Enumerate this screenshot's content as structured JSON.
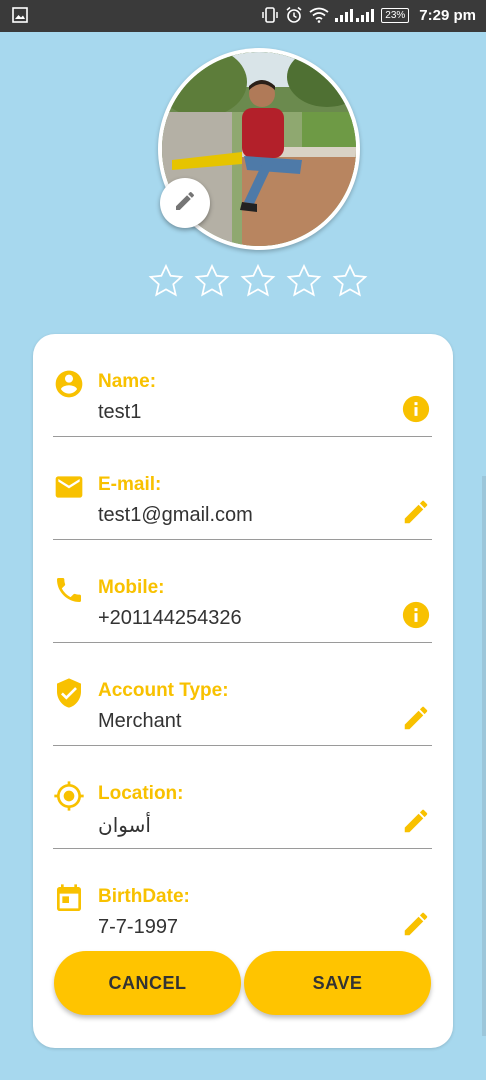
{
  "status_bar": {
    "battery": "23%",
    "time": "7:29 pm"
  },
  "rating": {
    "value": 0,
    "max": 5
  },
  "profile": {
    "fields": [
      {
        "label": "Name:",
        "value": "test1",
        "icon": "person-icon",
        "action": "info-icon"
      },
      {
        "label": "E-mail:",
        "value": "test1@gmail.com",
        "icon": "email-icon",
        "action": "edit-icon"
      },
      {
        "label": "Mobile:",
        "value": "+201144254326",
        "icon": "phone-icon",
        "action": "info-icon"
      },
      {
        "label": "Account Type:",
        "value": "Merchant",
        "icon": "shield-check-icon",
        "action": "edit-icon"
      },
      {
        "label": "Location:",
        "value": "أسوان",
        "icon": "location-icon",
        "action": "edit-icon"
      },
      {
        "label": "BirthDate:",
        "value": "7-7-1997",
        "icon": "calendar-icon",
        "action": "edit-icon"
      }
    ]
  },
  "buttons": {
    "cancel": "CANCEL",
    "save": "SAVE"
  },
  "colors": {
    "accent": "#ffc400",
    "label": "#f8c100",
    "background": "#a7d8ee"
  }
}
